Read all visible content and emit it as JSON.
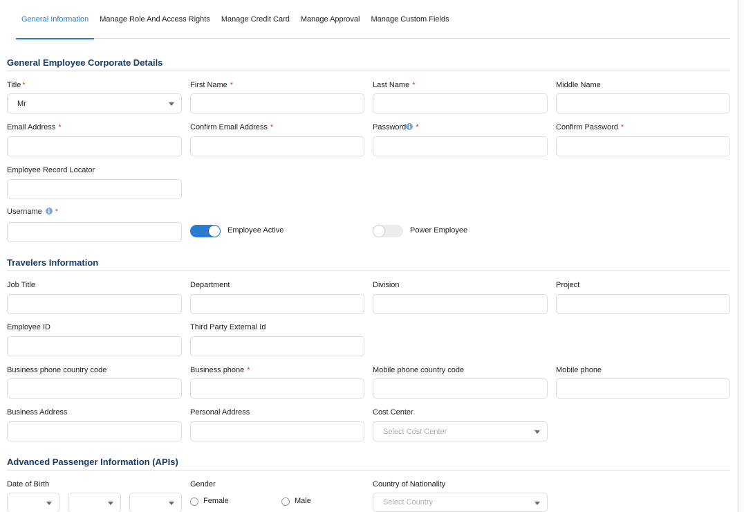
{
  "tabs": [
    {
      "label": "General Information",
      "active": true
    },
    {
      "label": "Manage Role And Access Rights",
      "active": false
    },
    {
      "label": "Manage Credit Card",
      "active": false
    },
    {
      "label": "Manage Approval",
      "active": false
    },
    {
      "label": "Manage Custom Fields",
      "active": false
    }
  ],
  "sections": {
    "corporate": "General Employee Corporate Details",
    "travelers": "Travelers Information",
    "apis": "Advanced Passenger Information (APIs)"
  },
  "fields": {
    "title": {
      "label": "Title",
      "value": "Mr"
    },
    "first_name": {
      "label": "First Name"
    },
    "last_name": {
      "label": "Last Name"
    },
    "middle_name": {
      "label": "Middle Name"
    },
    "email": {
      "label": "Email Address"
    },
    "confirm_email": {
      "label": "Confirm Email Address"
    },
    "password": {
      "label": "Password"
    },
    "confirm_password": {
      "label": "Confirm Password"
    },
    "record_locator": {
      "label": "Employee Record Locator"
    },
    "username": {
      "label": "Username"
    },
    "job_title": {
      "label": "Job Title"
    },
    "department": {
      "label": "Department"
    },
    "division": {
      "label": "Division"
    },
    "project": {
      "label": "Project"
    },
    "employee_id": {
      "label": "Employee ID"
    },
    "third_party_id": {
      "label": "Third Party External Id"
    },
    "business_phone_cc": {
      "label": "Business phone country code"
    },
    "business_phone": {
      "label": "Business phone"
    },
    "mobile_phone_cc": {
      "label": "Mobile phone country code"
    },
    "mobile_phone": {
      "label": "Mobile phone"
    },
    "business_address": {
      "label": "Business Address"
    },
    "personal_address": {
      "label": "Personal Address"
    },
    "cost_center": {
      "label": "Cost Center",
      "placeholder": "Select Cost Center"
    },
    "dob": {
      "label": "Date of Birth"
    },
    "gender": {
      "label": "Gender",
      "options": [
        "Female",
        "Male"
      ]
    },
    "nationality": {
      "label": "Country of Nationality",
      "placeholder": "Select Country"
    }
  },
  "toggles": {
    "employee_active": {
      "label": "Employee Active",
      "on": true
    },
    "power_employee": {
      "label": "Power Employee",
      "on": false
    }
  },
  "required_mark": "*",
  "info_glyph": "i",
  "colors": {
    "accent": "#2b7bd0",
    "section_title": "#1b3c6b",
    "required": "#dd3333"
  }
}
